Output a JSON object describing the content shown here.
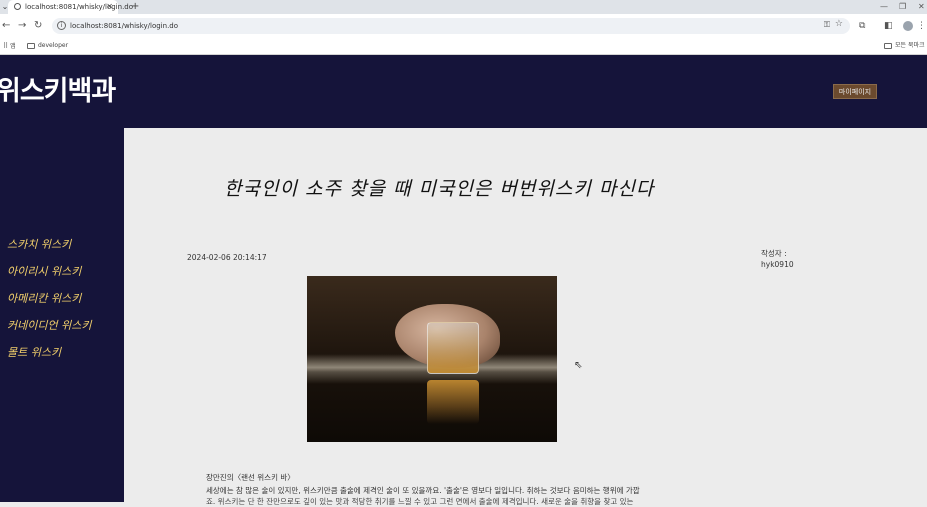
{
  "browser": {
    "tab_title": "localhost:8081/whisky/login.do",
    "url": "localhost:8081/whisky/login.do",
    "new_tab_symbol": "+",
    "bookmarks": [
      {
        "label": "앱"
      },
      {
        "label": "developer"
      }
    ],
    "other_bookmarks": "모든 북마크"
  },
  "header": {
    "logo": "위스키백과",
    "mypage_button": "마이페이지"
  },
  "sidebar": {
    "items": [
      {
        "label": "스카치 위스키"
      },
      {
        "label": "아이리시 위스키"
      },
      {
        "label": "아메리칸 위스키"
      },
      {
        "label": "커네이디언 위스키"
      },
      {
        "label": "몰트 위스키"
      }
    ]
  },
  "article": {
    "title": "한국인이 소주 찾을 때 미국인은 버번위스키 마신다",
    "date": "2024-02-06 20:14:17",
    "author_label": "작성자 :",
    "author": "hyk0910",
    "caption": "장만진의〈랜선 위스키 바〉",
    "body_line1": "세상에는 참 많은 술이 있지만, 위스키만큼 출술에 제격인 술이 또 있을까요. '출술'은 영보다 일입니다. 취하는 것보다 음미하는 행위에 가깝",
    "body_line2": "죠. 위스키는 단 한 잔만으로도 깊이 있는 맛과 적당한 취기를 느낄 수 있고 그런 면에서 출술에 제격입니다. 새로운 술을 취향을 찾고 있는"
  }
}
